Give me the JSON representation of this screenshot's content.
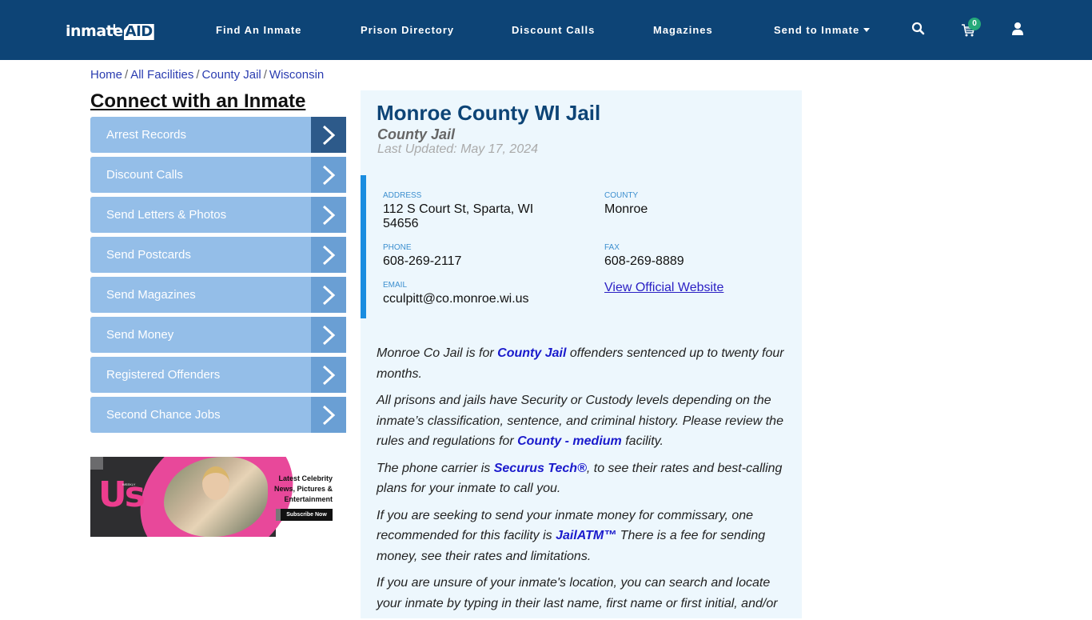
{
  "header": {
    "logo": {
      "part1": "inmate",
      "part2": "AID",
      "plus": "+"
    },
    "nav": [
      {
        "label": "Find An Inmate"
      },
      {
        "label": "Prison Directory"
      },
      {
        "label": "Discount Calls"
      },
      {
        "label": "Magazines"
      },
      {
        "label": "Send to Inmate",
        "has_dropdown": true
      }
    ],
    "icons": {
      "search": "search-icon",
      "cart": "cart-icon",
      "user": "user-icon"
    },
    "cart_count": "0",
    "colors": {
      "background": "#0d4476",
      "badge": "#25a97a"
    }
  },
  "breadcrumb": [
    {
      "label": "Home"
    },
    {
      "label": "All Facilities"
    },
    {
      "label": "County Jail"
    },
    {
      "label": "Wisconsin"
    }
  ],
  "sidebar": {
    "title": "Connect with an Inmate",
    "items": [
      {
        "label": "Arrest Records"
      },
      {
        "label": "Discount Calls"
      },
      {
        "label": "Send Letters & Photos"
      },
      {
        "label": "Send Postcards"
      },
      {
        "label": "Send Magazines"
      },
      {
        "label": "Send Money"
      },
      {
        "label": "Registered Offenders"
      },
      {
        "label": "Second Chance Jobs"
      }
    ],
    "ad": {
      "brand": "Us",
      "brand_sub": "WEEKLY",
      "line1": "Latest Celebrity",
      "line2": "News, Pictures &",
      "line3": "Entertainment",
      "button": "Subscribe Now"
    }
  },
  "facility": {
    "title": "Monroe County WI Jail",
    "type": "County Jail",
    "last_updated": "Last Updated: May 17, 2024",
    "fields": {
      "address_label": "Address",
      "address_line1": "112 S Court St, Sparta, WI",
      "address_line2": "54656",
      "county_label": "County",
      "county": "Monroe",
      "phone_label": "Phone",
      "phone": "608-269-2117",
      "fax_label": "Fax",
      "fax": "608-269-8889",
      "email_label": "Email",
      "email": "cculpitt@co.monroe.wi.us",
      "website_link": "View Official Website"
    },
    "paragraphs": {
      "p1_a": "Monroe Co Jail is for ",
      "p1_link": "County Jail",
      "p1_b": " offenders sentenced up to twenty four months.",
      "p2_a": "All prisons and jails have Security or Custody levels depending on the inmate’s classification, sentence, and criminal history. Please review the rules and regulations for ",
      "p2_link": "County - medium",
      "p2_b": " facility.",
      "p3_a": "The phone carrier is ",
      "p3_link": "Securus Tech®",
      "p3_b": ", to see their rates and best-calling plans for your inmate to call you.",
      "p4_a": "If you are seeking to send your inmate money for commissary, one recommended for this facility is ",
      "p4_link": "JailATM™",
      "p4_b": " There is a fee for sending money, see their rates and limitations.",
      "p5": "If you are unsure of your inmate's location, you can search and locate your inmate by typing in their last name, first name or first initial, and/or"
    }
  }
}
